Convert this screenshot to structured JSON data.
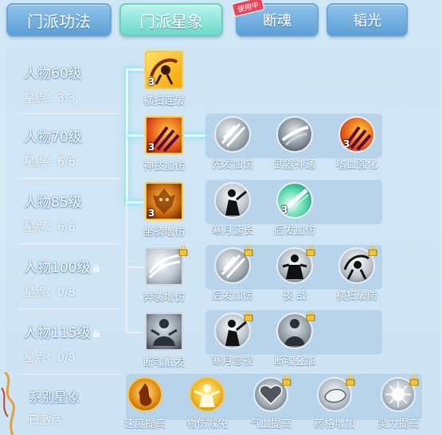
{
  "tabs": [
    {
      "label": "门派功法",
      "active": false
    },
    {
      "label": "门派星象",
      "active": true
    },
    {
      "label": "断魂",
      "active": false,
      "badge": "使用中"
    },
    {
      "label": "韬光",
      "active": false
    }
  ],
  "rows": [
    {
      "level": "人物60级",
      "stars": "星点：3/3",
      "locked": false
    },
    {
      "level": "人物70级",
      "stars": "星点：6/6",
      "locked": false
    },
    {
      "level": "人物85级",
      "stars": "星点：6/6",
      "locked": false
    },
    {
      "level": "人物100级",
      "stars": "星点：0/8",
      "locked": true
    },
    {
      "level": "人物115级",
      "stars": "星点：0/8",
      "locked": true
    }
  ],
  "main_nodes": [
    {
      "label": "横扫连破",
      "count": "3",
      "icon": "sweep-slash-icon"
    },
    {
      "label": "神技加伤",
      "count": "3",
      "icon": "claw-strike-icon"
    },
    {
      "label": "坐骑增伤",
      "count": "3",
      "icon": "flame-beast-icon"
    },
    {
      "label": "奔袭增伤",
      "count": "",
      "icon": "swirl-wind-icon",
      "locked": true
    },
    {
      "label": "断魂触发",
      "count": "",
      "icon": "shadow-figure-icon"
    }
  ],
  "branch_nodes": [
    [
      {
        "label": "先发加伤",
        "count": "",
        "icon": "blade-flurry-icon"
      },
      {
        "label": "武器神通",
        "count": "",
        "icon": "weapon-art-icon"
      },
      {
        "label": "嗜血强化",
        "count": "3",
        "icon": "blood-claw-icon"
      }
    ],
    [
      {
        "label": "寒月延长",
        "count": "",
        "icon": "moon-warrior-icon"
      },
      {
        "label": "后发加伤",
        "count": "3",
        "icon": "green-sword-icon"
      }
    ],
    [
      {
        "label": "后发加伤",
        "count": "",
        "icon": "blade-flurry-icon",
        "locked": true
      },
      {
        "label": "夜 战",
        "count": "",
        "icon": "night-fight-icon",
        "locked": true
      },
      {
        "label": "横扫破防",
        "count": "",
        "icon": "sweep-break-icon",
        "locked": true
      }
    ],
    [
      {
        "label": "寒月忽视",
        "count": "",
        "icon": "moon-warrior-icon",
        "locked": true
      },
      {
        "label": "断魂叠加",
        "count": "",
        "icon": "shadow-figure-icon",
        "locked": true
      }
    ]
  ],
  "series": {
    "title": "系别星象",
    "status": "已激活",
    "items": [
      {
        "label": "速度提高",
        "icon": "speed-flame-icon",
        "locked": false
      },
      {
        "label": "物伤减免",
        "icon": "golden-warrior-icon",
        "locked": false
      },
      {
        "label": "气血提高",
        "icon": "heart-icon",
        "locked": true
      },
      {
        "label": "药格增加",
        "icon": "potion-icon",
        "locked": true
      },
      {
        "label": "灵力提高",
        "icon": "spirit-orb-icon",
        "locked": true
      }
    ]
  }
}
